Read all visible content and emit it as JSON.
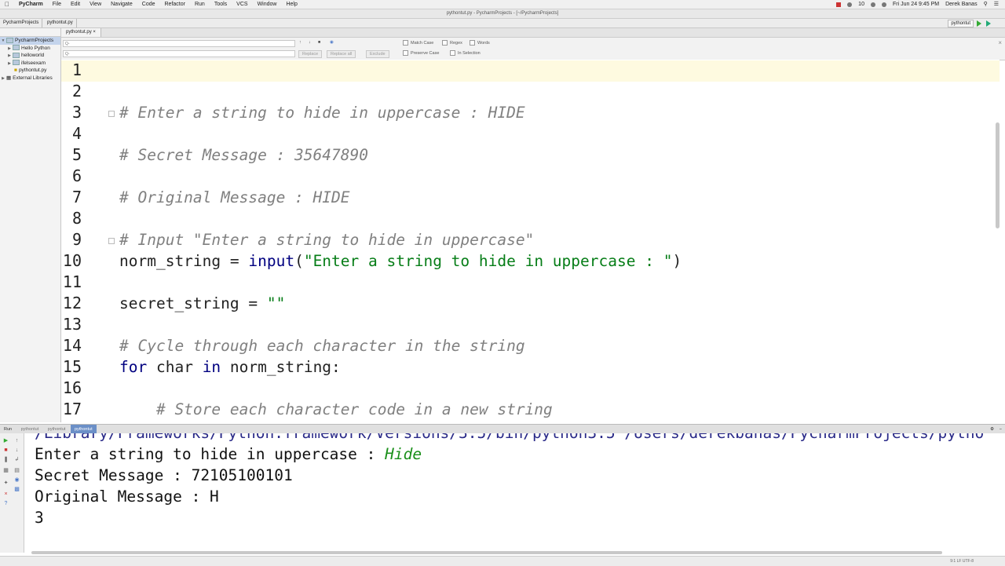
{
  "menubar": {
    "app": "PyCharm",
    "items": [
      "File",
      "Edit",
      "View",
      "Navigate",
      "Code",
      "Refactor",
      "Run",
      "Tools",
      "VCS",
      "Window",
      "Help"
    ],
    "clock": "Fri Jun 24  9:45 PM",
    "user": "Derek Banas",
    "battery": "10"
  },
  "window": {
    "title": "pythontut.py - PycharmProjects - [~/PycharmProjects]"
  },
  "navbar": {
    "crumbs": [
      "PycharmProjects",
      "pythontut.py"
    ],
    "run_config": "pythontut"
  },
  "project": {
    "items": [
      {
        "label": "PycharmProjects",
        "selected": true
      },
      {
        "label": "Hello Python"
      },
      {
        "label": "helloworld"
      },
      {
        "label": "ifelseexam"
      },
      {
        "label": "pythontut.py"
      },
      {
        "label": "External Libraries"
      }
    ]
  },
  "editor_tab": {
    "label": "pythontut.py"
  },
  "findbar": {
    "search_placeholder": "Q-",
    "replace_placeholder": "Q-",
    "replace": "Replace",
    "replace_all": "Replace all",
    "exclude": "Exclude",
    "match_case": "Match Case",
    "regex": "Regex",
    "words": "Words",
    "preserve_case": "Preserve Case",
    "in_selection": "In Selection"
  },
  "editor": {
    "lines": [
      {
        "n": "1",
        "parts": []
      },
      {
        "n": "2",
        "parts": []
      },
      {
        "n": "3",
        "parts": [
          {
            "t": "# Enter a string to hide in uppercase : HIDE",
            "c": "cm"
          }
        ]
      },
      {
        "n": "4",
        "parts": []
      },
      {
        "n": "5",
        "parts": [
          {
            "t": "# Secret Message : 35647890",
            "c": "cm"
          }
        ]
      },
      {
        "n": "6",
        "parts": []
      },
      {
        "n": "7",
        "parts": [
          {
            "t": "# Original Message : HIDE",
            "c": "cm"
          }
        ]
      },
      {
        "n": "8",
        "parts": []
      },
      {
        "n": "9",
        "parts": [
          {
            "t": "# Input \"Enter a string to hide in uppercase\"",
            "c": "cm"
          }
        ]
      },
      {
        "n": "10",
        "parts": [
          {
            "t": "norm_string = ",
            "c": ""
          },
          {
            "t": "input",
            "c": "fn"
          },
          {
            "t": "(",
            "c": ""
          },
          {
            "t": "\"Enter a string to hide in uppercase : \"",
            "c": "str"
          },
          {
            "t": ")",
            "c": ""
          }
        ]
      },
      {
        "n": "11",
        "parts": []
      },
      {
        "n": "12",
        "parts": [
          {
            "t": "secret_string = ",
            "c": ""
          },
          {
            "t": "\"\"",
            "c": "str"
          }
        ]
      },
      {
        "n": "13",
        "parts": []
      },
      {
        "n": "14",
        "parts": [
          {
            "t": "# Cycle through each character in the string",
            "c": "cm"
          }
        ]
      },
      {
        "n": "15",
        "parts": [
          {
            "t": "for",
            "c": "kw"
          },
          {
            "t": " char ",
            "c": ""
          },
          {
            "t": "in",
            "c": "kw"
          },
          {
            "t": " norm_string:",
            "c": ""
          }
        ]
      },
      {
        "n": "16",
        "parts": []
      },
      {
        "n": "17",
        "parts": [
          {
            "t": "    # Store each character code in a new string",
            "c": "cm"
          }
        ]
      }
    ]
  },
  "run_panel": {
    "label": "Run",
    "tabs": [
      "pythontut",
      "pythontut",
      "pythontut"
    ],
    "active_tab": 2,
    "command_line": "/Library/Frameworks/Python.framework/Versions/3.5/bin/python3.5 /Users/derekbanas/PycharmProjects/pytho",
    "prompt": "Enter a string to hide in uppercase : ",
    "user_input": "Hide",
    "output": [
      "Secret Message : 72105100101",
      "Original Message : H",
      "3"
    ]
  },
  "statusbar": {
    "text": "9:1  LF  UTF-8"
  }
}
